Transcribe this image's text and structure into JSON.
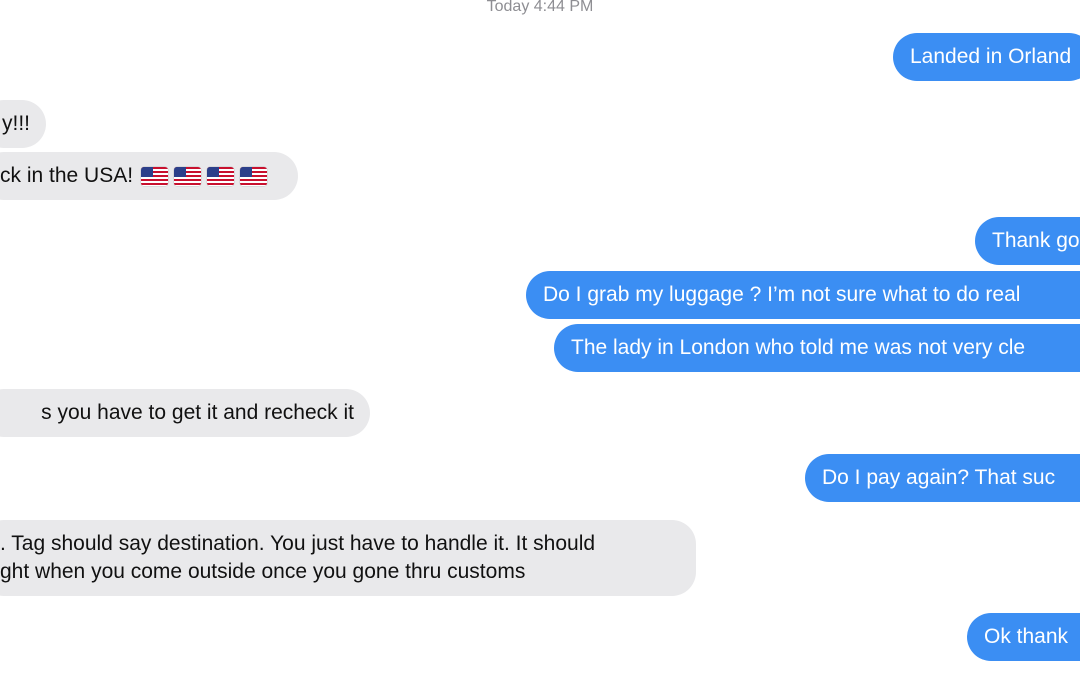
{
  "conversation": {
    "timestamp": "Today 4:44 PM",
    "messages": [
      {
        "direction": "outgoing",
        "text": "Landed in Orland"
      },
      {
        "direction": "incoming",
        "text": "y!!!"
      },
      {
        "direction": "incoming",
        "text": "ck in the USA!",
        "emoji": "us-flag-emoji ×4"
      },
      {
        "direction": "outgoing",
        "text": "Thank go"
      },
      {
        "direction": "outgoing",
        "text": "Do I grab my luggage ? I’m not sure what to do real"
      },
      {
        "direction": "outgoing",
        "text": "The lady in London who told me was not very cle"
      },
      {
        "direction": "incoming",
        "text": "s you have to get it and recheck it"
      },
      {
        "direction": "outgoing",
        "text": "Do I pay again? That suc"
      },
      {
        "direction": "incoming",
        "lines": [
          ". Tag should say destination. You just have to handle it. It should",
          "ght when you come outside once you gone thru customs"
        ]
      },
      {
        "direction": "outgoing",
        "text": "Ok thank"
      }
    ]
  }
}
